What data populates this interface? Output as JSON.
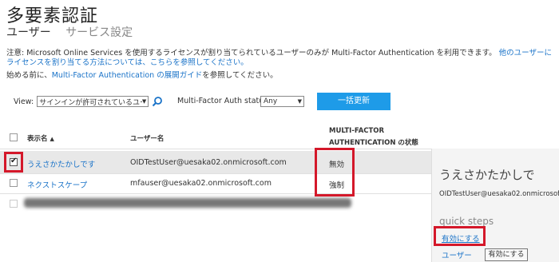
{
  "page": {
    "title": "多要素認証",
    "tabs": [
      {
        "label": "ユーザー",
        "active": true
      },
      {
        "label": "サービス設定",
        "active": false
      }
    ]
  },
  "notice": {
    "prefix": "注意: Microsoft Online Services を使用するライセンスが割り当てられているユーザーのみが Multi-Factor Authentication を利用できます。",
    "link1": "他のユーザーにライセンスを割り当てる方法については、こちらを参照してください。",
    "line2_prefix": "始める前に、",
    "line2_link": "Multi-Factor Authentication の展開ガイド",
    "line2_suffix": "を参照してください。"
  },
  "filters": {
    "view_label": "View:",
    "view_value": "サインインが許可されているユーザ",
    "mfa_status_label": "Multi-Factor Auth status:",
    "mfa_status_value": "Any",
    "bulk_update_label": "一括更新"
  },
  "table": {
    "columns": {
      "display_name": "表示名",
      "user_name": "ユーザー名",
      "mfa_status_line1": "MULTI-FACTOR",
      "mfa_status_line2": "AUTHENTICATION の状態"
    },
    "rows": [
      {
        "display_name": "うえさかたかしです",
        "user_name": "OIDTestUser@uesaka02.onmicrosoft.com",
        "status": "無効",
        "checked": true
      },
      {
        "display_name": "ネクストスケープ",
        "user_name": "mfauser@uesaka02.onmicrosoft.com",
        "status": "強制",
        "checked": false
      }
    ]
  },
  "side_panel": {
    "name": "うえさかたかしで",
    "email": "OIDTestUser@uesaka02.onmicrosoft",
    "quick_steps": "quick steps",
    "enable_link": "有効にする",
    "user_link": "ユーザー",
    "tooltip": "有効にする"
  },
  "colors": {
    "accent": "#1e9be8",
    "link": "#1a73c8",
    "highlight": "#d4182a"
  }
}
